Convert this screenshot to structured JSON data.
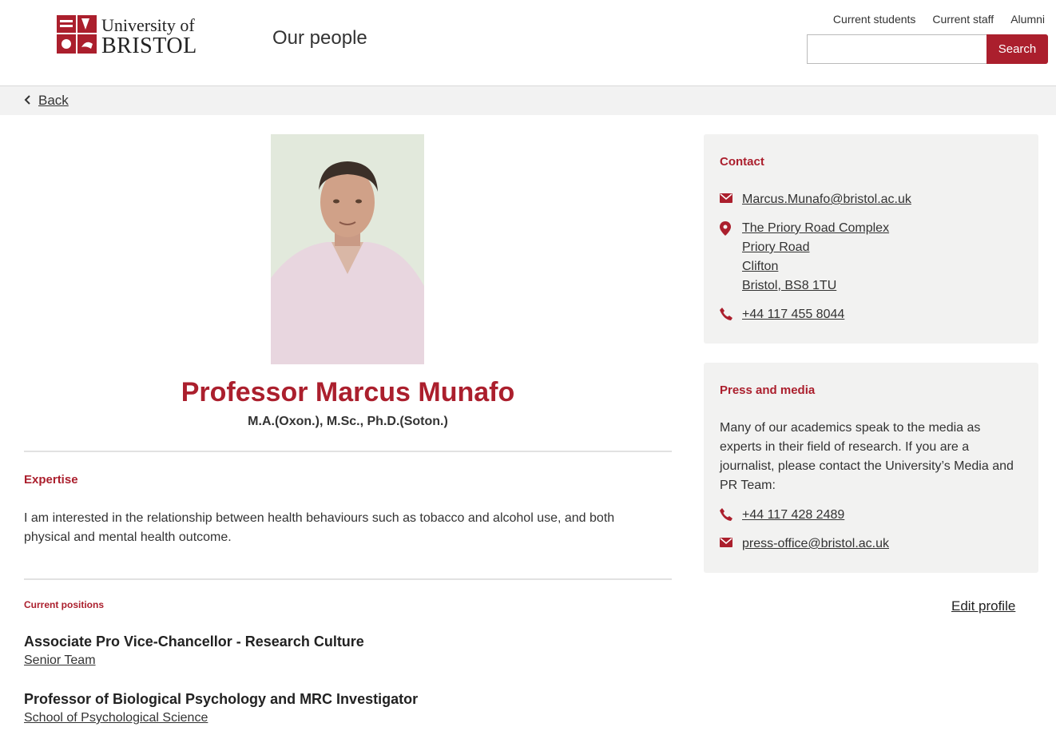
{
  "header": {
    "logo_line1": "University of",
    "logo_line2": "BRISTOL",
    "site_title": "Our people",
    "links": [
      "Current students",
      "Current staff",
      "Alumni"
    ],
    "search_placeholder": "",
    "search_button": "Search"
  },
  "nav": {
    "back": "Back"
  },
  "profile": {
    "name": "Professor Marcus Munafo",
    "qualifications": "M.A.(Oxon.), M.Sc., Ph.D.(Soton.)",
    "expertise_heading": "Expertise",
    "expertise_text": "I am interested in the relationship between health behaviours such as tobacco and alcohol use, and both physical and mental health outcome.",
    "positions_heading": "Current positions",
    "positions": [
      {
        "title": "Associate Pro Vice-Chancellor - Research Culture",
        "department": "Senior Team"
      },
      {
        "title": "Professor of Biological Psychology and MRC Investigator",
        "department": "School of Psychological Science"
      }
    ]
  },
  "contact": {
    "heading": "Contact",
    "email": "Marcus.Munafo@bristol.ac.uk",
    "address": [
      "The Priory Road Complex",
      "Priory Road",
      "Clifton",
      "Bristol, BS8 1TU"
    ],
    "phone": "+44 117 455 8044"
  },
  "press": {
    "heading": "Press and media",
    "text": "Many of our academics speak to the media as experts in their field of research. If you are a journalist, please contact the University’s Media and PR Team:",
    "phone": "+44 117 428 2489",
    "email": "press-office@bristol.ac.uk"
  },
  "edit_profile": "Edit profile",
  "colors": {
    "accent": "#ab1f2d",
    "card_bg": "#f2f2f1"
  }
}
